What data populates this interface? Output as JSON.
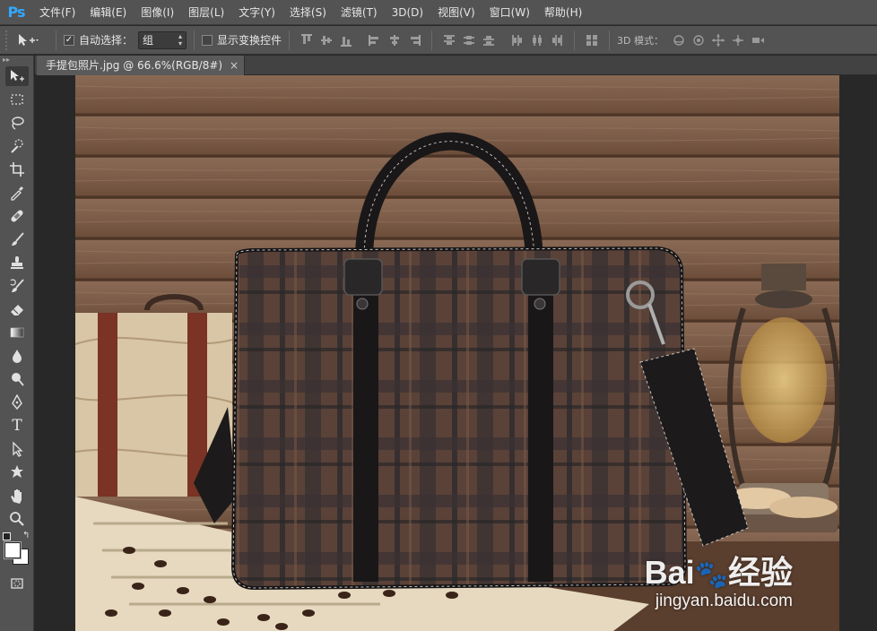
{
  "app": {
    "logo": "Ps"
  },
  "menu": [
    "文件(F)",
    "编辑(E)",
    "图像(I)",
    "图层(L)",
    "文字(Y)",
    "选择(S)",
    "滤镜(T)",
    "3D(D)",
    "视图(V)",
    "窗口(W)",
    "帮助(H)"
  ],
  "options": {
    "auto_select_label": "自动选择：",
    "auto_select_checked": true,
    "auto_select_value": "组",
    "show_transform_label": "显示变换控件",
    "show_transform_checked": false,
    "mode_3d_label": "3D 模式："
  },
  "document": {
    "tab_title": "手提包照片.jpg @ 66.6%(RGB/8#)",
    "close_glyph": "×"
  },
  "toolbar": {
    "collapse_glyph": "▸▸",
    "tools": [
      "move-icon",
      "marquee-icon",
      "lasso-icon",
      "quick-select-icon",
      "crop-icon",
      "eyedropper-icon",
      "healing-brush-icon",
      "brush-icon",
      "clone-stamp-icon",
      "history-brush-icon",
      "eraser-icon",
      "gradient-icon",
      "blur-icon",
      "dodge-icon",
      "pen-icon",
      "type-icon",
      "path-select-icon",
      "shape-icon",
      "hand-icon",
      "zoom-icon"
    ],
    "type_glyph": "T",
    "foreground": "#ffffff",
    "background": "#ffffff"
  },
  "watermark": {
    "logo": "Bai",
    "logo_cn": "经验",
    "url": "jingyan.baidu.com"
  },
  "colors": {
    "menubar": "#535353",
    "workspace": "#282828",
    "accent": "#31a8ff"
  }
}
